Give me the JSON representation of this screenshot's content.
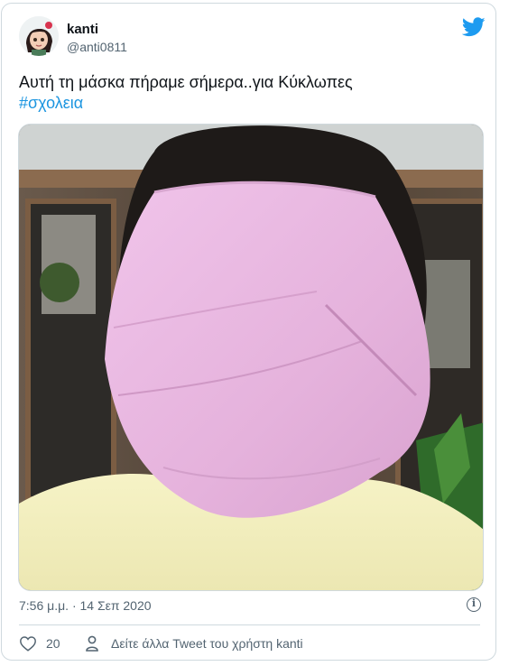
{
  "tweet": {
    "display_name": "kanti",
    "handle": "@anti0811",
    "text_main": "Αυτή τη μάσκα πήραμε σήμερα..για Κύκλωπες",
    "hashtag": "#σχολεια",
    "timestamp": "7:56 μ.μ. · 14 Σεπ 2020",
    "likes": "20",
    "more_link": "Δείτε άλλα Tweet του χρήστη kanti"
  },
  "colors": {
    "accent": "#1b95e0",
    "muted": "#536471",
    "mask": "#e9b6e0"
  },
  "icons": [
    "twitter-bird-icon",
    "info-icon",
    "heart-icon",
    "person-icon"
  ]
}
